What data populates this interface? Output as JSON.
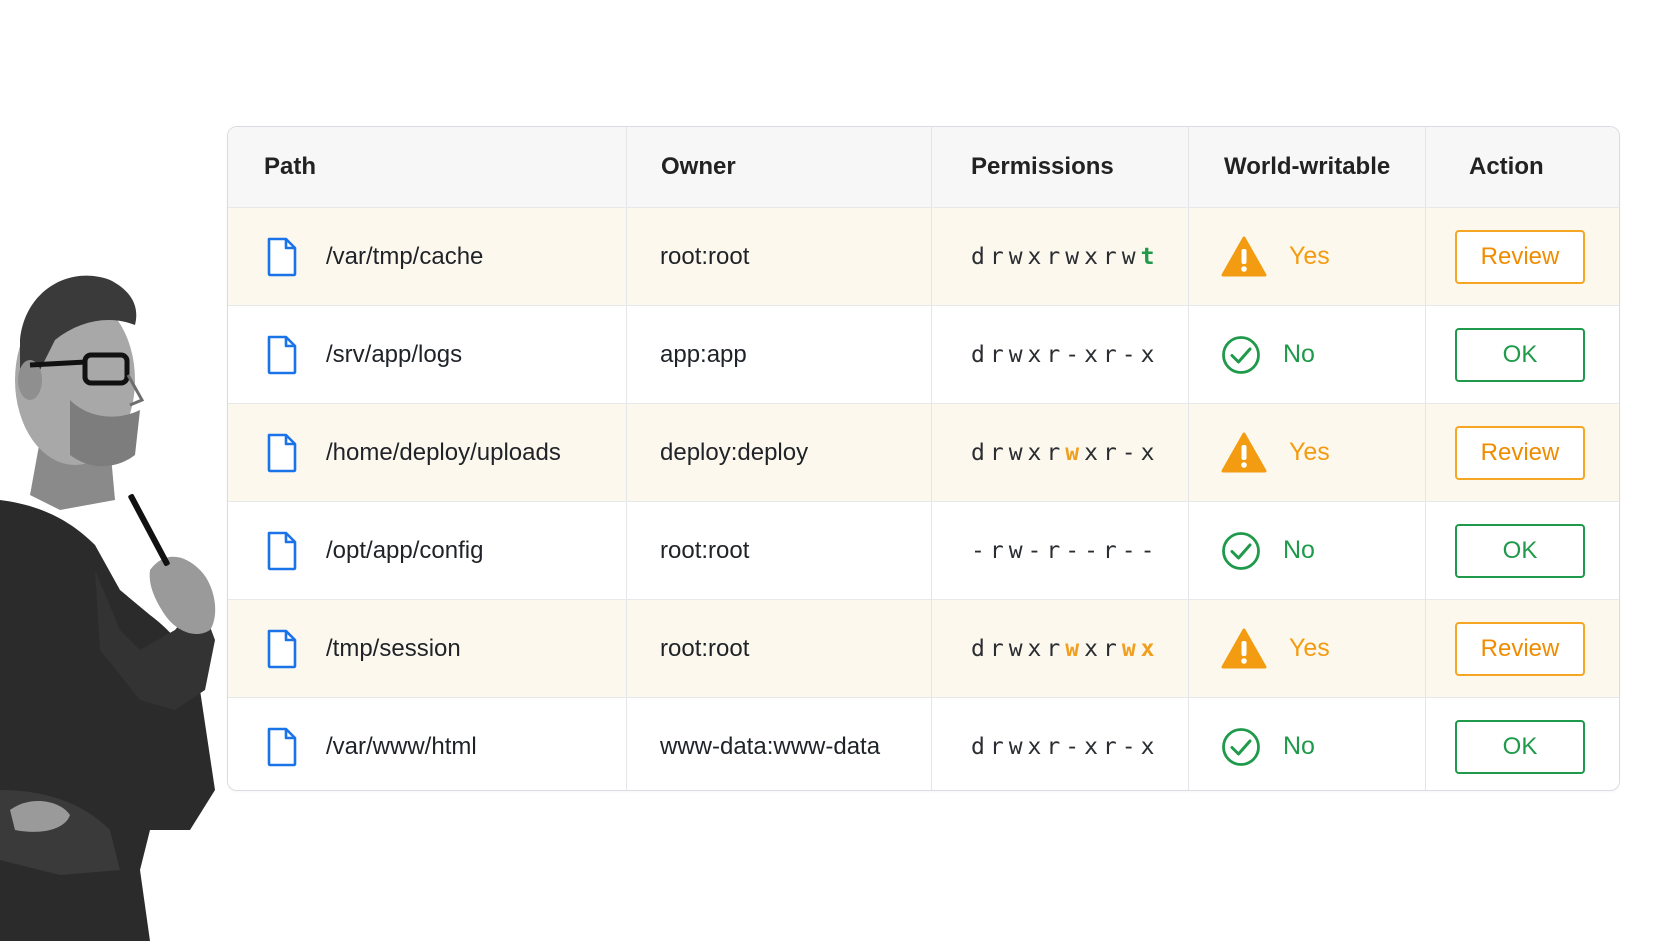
{
  "table": {
    "headers": [
      "Path",
      "Owner",
      "Permissions",
      "World-writable",
      "Action"
    ],
    "rows": [
      {
        "path": "/var/tmp/cache",
        "owner": "root:root",
        "perm_parts": [
          {
            "t": "drwxrwxrw",
            "c": ""
          },
          {
            "t": "t",
            "c": "green"
          }
        ],
        "ww": "Yes",
        "status": "warn",
        "action": "Review"
      },
      {
        "path": "/srv/app/logs",
        "owner": "app:app",
        "perm_parts": [
          {
            "t": "drwxr-xr-x",
            "c": ""
          }
        ],
        "ww": "No",
        "status": "ok",
        "action": "OK"
      },
      {
        "path": "/home/deploy/uploads",
        "owner": "deploy:deploy",
        "perm_parts": [
          {
            "t": "drwxr",
            "c": ""
          },
          {
            "t": "w",
            "c": "orange"
          },
          {
            "t": "xr-x",
            "c": ""
          }
        ],
        "ww": "Yes",
        "status": "warn",
        "action": "Review"
      },
      {
        "path": "/opt/app/config",
        "owner": "root:root",
        "perm_parts": [
          {
            "t": "-rw-r--r--",
            "c": ""
          }
        ],
        "ww": "No",
        "status": "ok",
        "action": "OK"
      },
      {
        "path": "/tmp/session",
        "owner": "root:root",
        "perm_parts": [
          {
            "t": "drwxr",
            "c": ""
          },
          {
            "t": "w",
            "c": "orange"
          },
          {
            "t": "xr",
            "c": ""
          },
          {
            "t": "wx",
            "c": "orange"
          }
        ],
        "ww": "Yes",
        "status": "warn",
        "action": "Review"
      },
      {
        "path": "/var/www/html",
        "owner": "www-data:www-data",
        "perm_parts": [
          {
            "t": "drwxr-xr-x",
            "c": ""
          }
        ],
        "ww": "No",
        "status": "ok",
        "action": "OK"
      }
    ]
  },
  "colors": {
    "warning_orange": "#f39c12",
    "ok_green": "#1f9a4a",
    "file_icon_blue": "#1a73e8",
    "warn_row_bg": "#fdf8ee"
  },
  "icons": {
    "file": "file-icon",
    "warning": "warning-icon",
    "check": "check-circle-icon"
  }
}
